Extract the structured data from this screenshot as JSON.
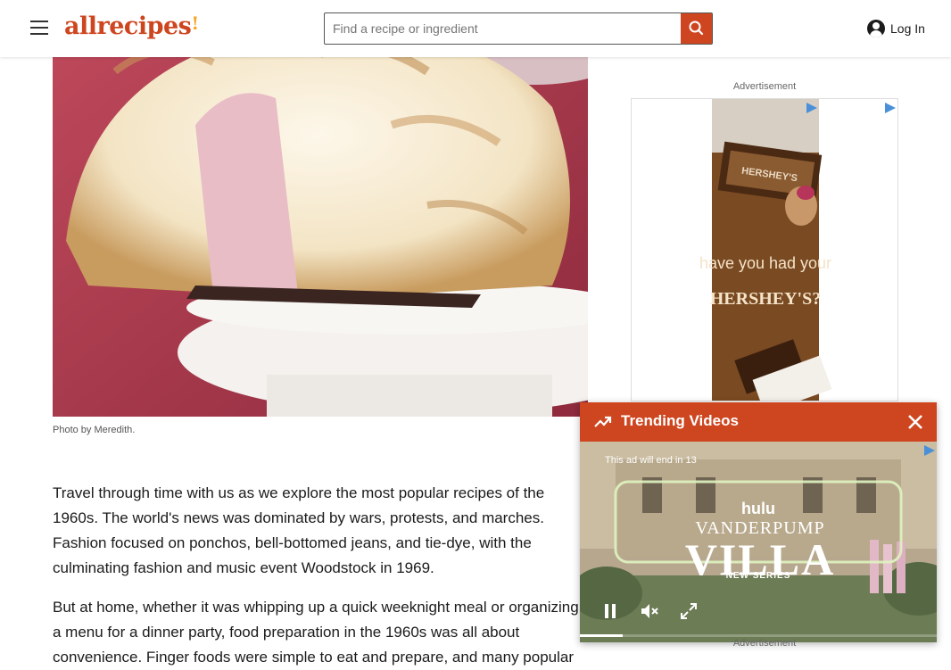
{
  "header": {
    "logo_text": "allrecipes",
    "search_placeholder": "Find a recipe or ingredient",
    "login_label": "Log In"
  },
  "article": {
    "photo_caption": "Photo by Meredith.",
    "paragraph1": "Travel through time with us as we explore the most popular recipes of the 1960s. The world's news was dominated by wars, protests, and marches. Fashion focused on ponchos, bell-bottomed jeans, and tie-dye, with the culminating fashion and music event Woodstock in 1969.",
    "paragraph2": "But at home, whether it was whipping up a quick weeknight meal or organizing a menu for a dinner party, food preparation in the 1960s was all about convenience. Finger foods were simple to eat and prepare, and many popular"
  },
  "sidebar": {
    "ad_label_top": "Advertisement",
    "ad_banner_text": "have you had your",
    "ad_brand": "HERSHEY'S?",
    "ad_bar_label": "HERSHEY'S",
    "ad_label_bottom": "Advertisement"
  },
  "video": {
    "title": "Trending Videos",
    "countdown": "This ad will end in 13",
    "brand": "hulu",
    "show_line1": "VANDERPUMP",
    "show_line2": "VILLA",
    "show_tag": "NEW SERIES",
    "progress_fraction": 0.12
  },
  "colors": {
    "brand": "#ce4620",
    "accent": "#f5a623"
  },
  "icons": [
    "menu-icon",
    "search-icon",
    "account-icon",
    "trending-icon",
    "close-icon",
    "pause-icon",
    "mute-icon",
    "fullscreen-icon",
    "adchoices-icon"
  ]
}
